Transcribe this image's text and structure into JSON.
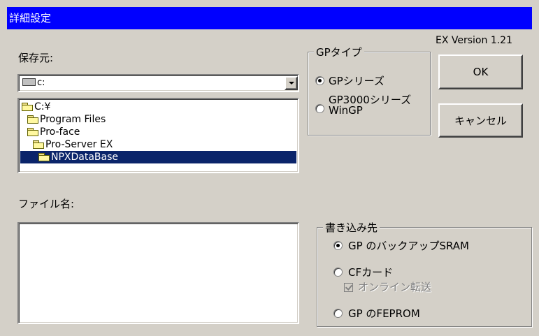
{
  "window": {
    "title": "詳細設定",
    "version": "EX Version 1.21"
  },
  "source": {
    "label": "保存元:",
    "drive": "c:",
    "tree": [
      {
        "label": "C:¥",
        "selected": false
      },
      {
        "label": "Program Files",
        "selected": false
      },
      {
        "label": "Pro-face",
        "selected": false
      },
      {
        "label": "Pro-Server EX",
        "selected": false
      },
      {
        "label": "NPXDataBase",
        "selected": true
      }
    ]
  },
  "filename": {
    "label": "ファイル名:"
  },
  "gp_type": {
    "title": "GPタイプ",
    "options": [
      {
        "label": "GPシリーズ",
        "selected": true
      },
      {
        "label": "GP3000シリーズ",
        "label2": "WinGP",
        "selected": false
      }
    ]
  },
  "buttons": {
    "ok": "OK",
    "cancel": "キャンセル"
  },
  "destination": {
    "title": "書き込み先",
    "options": [
      {
        "label": "GP のバックアップSRAM",
        "selected": true
      },
      {
        "label": "CFカード",
        "selected": false
      },
      {
        "label": "GP のFEPROM",
        "selected": false
      }
    ],
    "online_transfer": {
      "label": "オンライン転送",
      "checked": true,
      "disabled": true
    }
  }
}
